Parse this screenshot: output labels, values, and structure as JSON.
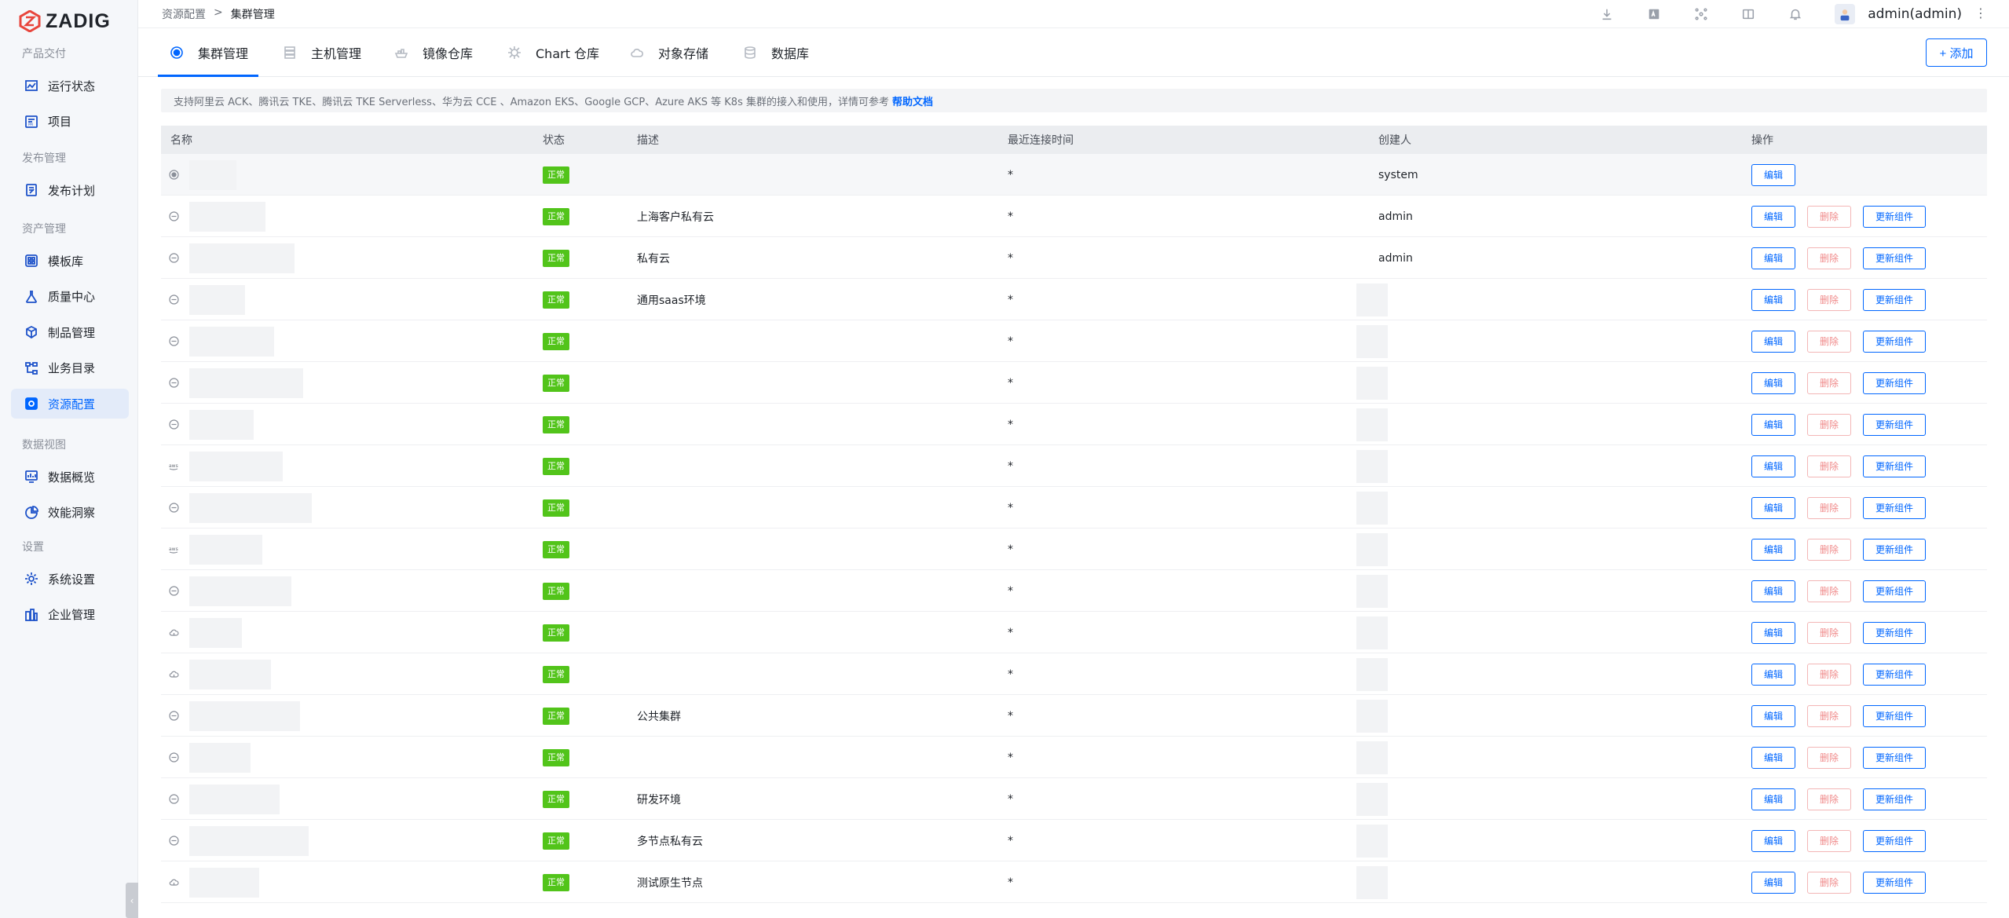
{
  "app": {
    "logo_text": "ZADIG"
  },
  "sidebar": {
    "groups": [
      {
        "label": "产品交付",
        "items": [
          {
            "label": "运行状态",
            "icon": "chart-icon"
          },
          {
            "label": "项目",
            "icon": "project-icon"
          }
        ]
      },
      {
        "label": "发布管理",
        "items": [
          {
            "label": "发布计划",
            "icon": "release-plan-icon"
          }
        ]
      },
      {
        "label": "资产管理",
        "items": [
          {
            "label": "模板库",
            "icon": "template-icon"
          },
          {
            "label": "质量中心",
            "icon": "flask-icon"
          },
          {
            "label": "制品管理",
            "icon": "package-icon"
          },
          {
            "label": "业务目录",
            "icon": "catalog-icon"
          },
          {
            "label": "资源配置",
            "icon": "gear-box-icon",
            "active": true
          }
        ]
      },
      {
        "label": "数据视图",
        "items": [
          {
            "label": "数据概览",
            "icon": "dashboard-icon"
          },
          {
            "label": "效能洞察",
            "icon": "pie-icon"
          }
        ]
      },
      {
        "label": "设置",
        "items": [
          {
            "label": "系统设置",
            "icon": "gear-icon"
          },
          {
            "label": "企业管理",
            "icon": "building-icon"
          }
        ]
      }
    ]
  },
  "header": {
    "breadcrumb": {
      "parent": "资源配置",
      "separator": ">",
      "current": "集群管理"
    },
    "icons": [
      "download-icon",
      "translate-icon",
      "network-icon",
      "book-icon",
      "bell-icon"
    ],
    "user": "admin(admin)"
  },
  "tabs": [
    {
      "label": "集群管理",
      "icon": "cluster-icon",
      "active": true
    },
    {
      "label": "主机管理",
      "icon": "host-icon"
    },
    {
      "label": "镜像仓库",
      "icon": "registry-icon"
    },
    {
      "label": "Chart 仓库",
      "icon": "helm-icon"
    },
    {
      "label": "对象存储",
      "icon": "cloud-icon"
    },
    {
      "label": "数据库",
      "icon": "database-icon"
    }
  ],
  "add_button": "+ 添加",
  "notice": {
    "text": "支持阿里云 ACK、腾讯云 TKE、腾讯云 TKE Serverless、华为云 CCE 、Amazon EKS、Google GCP、Azure AKS 等 K8s 集群的接入和使用，详情可参考",
    "link": "帮助文档"
  },
  "table": {
    "columns": {
      "name": "名称",
      "status": "状态",
      "desc": "描述",
      "time": "最近连接时间",
      "creator": "创建人",
      "ops": "操作"
    },
    "op_labels": {
      "edit": "编辑",
      "delete": "删除",
      "update": "更新组件"
    },
    "rows": [
      {
        "icon": "radio-icon",
        "status": "正常",
        "desc": "",
        "time": "*",
        "creator": "system",
        "ops": [
          "edit"
        ]
      },
      {
        "icon": "k8s-icon",
        "status": "正常",
        "desc": "上海客户私有云",
        "time": "*",
        "creator": "admin",
        "ops": [
          "edit",
          "delete",
          "update"
        ]
      },
      {
        "icon": "k8s-icon",
        "status": "正常",
        "desc": "私有云",
        "time": "*",
        "creator": "admin",
        "ops": [
          "edit",
          "delete",
          "update"
        ]
      },
      {
        "icon": "k8s-icon",
        "status": "正常",
        "desc": "通用saas环境",
        "time": "*",
        "creator": "",
        "ops": [
          "edit",
          "delete",
          "update"
        ]
      },
      {
        "icon": "k8s-icon",
        "status": "正常",
        "desc": "",
        "time": "*",
        "creator": "",
        "ops": [
          "edit",
          "delete",
          "update"
        ]
      },
      {
        "icon": "k8s-icon",
        "status": "正常",
        "desc": "",
        "time": "*",
        "creator": "",
        "ops": [
          "edit",
          "delete",
          "update"
        ]
      },
      {
        "icon": "k8s-icon",
        "status": "正常",
        "desc": "",
        "time": "*",
        "creator": "",
        "ops": [
          "edit",
          "delete",
          "update"
        ]
      },
      {
        "icon": "aws-icon",
        "status": "正常",
        "desc": "",
        "time": "*",
        "creator": "",
        "ops": [
          "edit",
          "delete",
          "update"
        ]
      },
      {
        "icon": "k8s-icon",
        "status": "正常",
        "desc": "",
        "time": "*",
        "creator": "",
        "ops": [
          "edit",
          "delete",
          "update"
        ]
      },
      {
        "icon": "aws-icon",
        "status": "正常",
        "desc": "",
        "time": "*",
        "creator": "",
        "ops": [
          "edit",
          "delete",
          "update"
        ]
      },
      {
        "icon": "k8s-icon",
        "status": "正常",
        "desc": "",
        "time": "*",
        "creator": "",
        "ops": [
          "edit",
          "delete",
          "update"
        ]
      },
      {
        "icon": "cloud-icon",
        "status": "正常",
        "desc": "",
        "time": "*",
        "creator": "",
        "ops": [
          "edit",
          "delete",
          "update"
        ]
      },
      {
        "icon": "cloud-icon",
        "status": "正常",
        "desc": "",
        "time": "*",
        "creator": "",
        "ops": [
          "edit",
          "delete",
          "update"
        ]
      },
      {
        "icon": "k8s-icon",
        "status": "正常",
        "desc": "公共集群",
        "time": "*",
        "creator": "",
        "ops": [
          "edit",
          "delete",
          "update"
        ]
      },
      {
        "icon": "k8s-icon",
        "status": "正常",
        "desc": "",
        "time": "*",
        "creator": "",
        "ops": [
          "edit",
          "delete",
          "update"
        ]
      },
      {
        "icon": "k8s-icon",
        "status": "正常",
        "desc": "研发环境",
        "time": "*",
        "creator": "",
        "ops": [
          "edit",
          "delete",
          "update"
        ]
      },
      {
        "icon": "k8s-icon",
        "status": "正常",
        "desc": "多节点私有云",
        "time": "*",
        "creator": "",
        "ops": [
          "edit",
          "delete",
          "update"
        ]
      },
      {
        "icon": "cloud-icon",
        "status": "正常",
        "desc": "测试原生节点",
        "time": "*",
        "creator": "",
        "ops": [
          "edit",
          "delete",
          "update"
        ]
      }
    ]
  },
  "colors": {
    "accent": "#0066ff",
    "status_ok": "#52c41a",
    "danger_light": "#f08a8a"
  }
}
